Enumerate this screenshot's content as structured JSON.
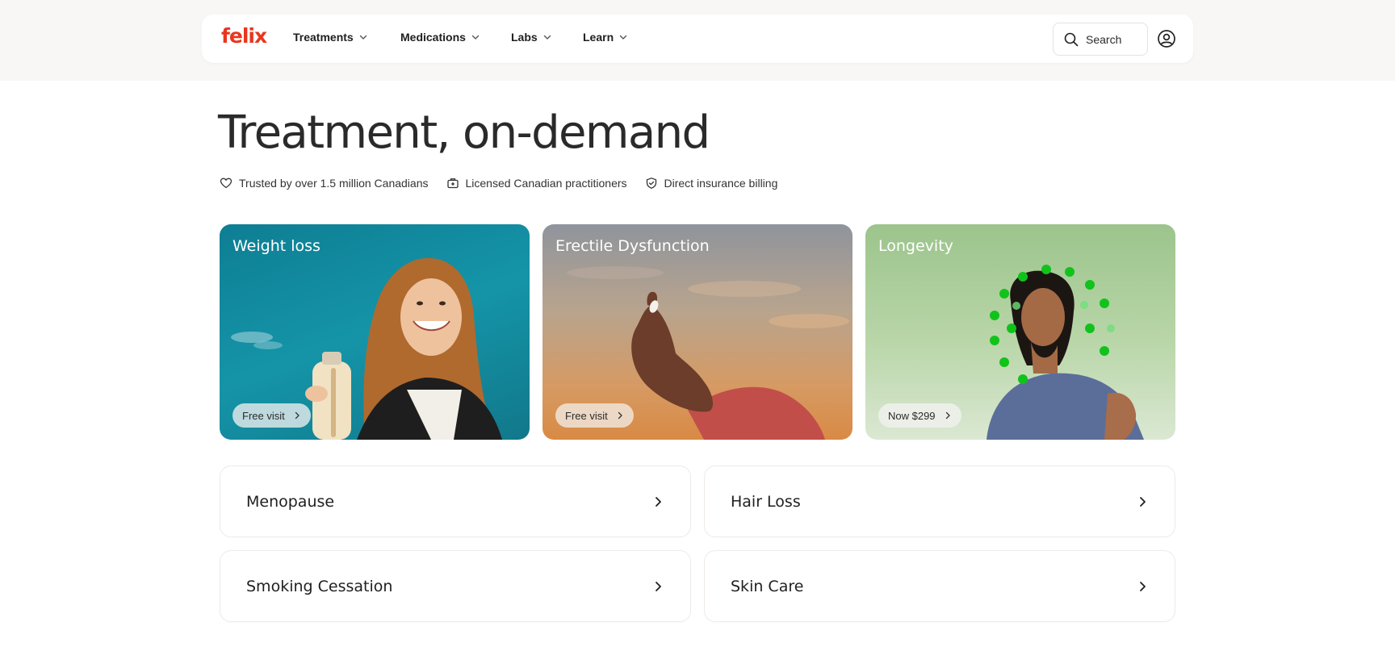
{
  "brand": {
    "logo_text": "felix",
    "accent": "#e8361e"
  },
  "nav": {
    "items": [
      {
        "label": "Treatments"
      },
      {
        "label": "Medications"
      },
      {
        "label": "Labs"
      },
      {
        "label": "Learn"
      }
    ],
    "search_placeholder": "Search",
    "icons": {
      "dropdown": "chevron-down-icon",
      "search": "search-icon",
      "account": "user-circle-icon"
    }
  },
  "hero": {
    "title": "Treatment, on-demand",
    "trust": [
      {
        "icon": "heart-icon",
        "text": "Trusted by over 1.5 million Canadians"
      },
      {
        "icon": "medical-bag-icon",
        "text": "Licensed Canadian practitioners"
      },
      {
        "icon": "shield-check-icon",
        "text": "Direct insurance billing"
      }
    ]
  },
  "featured_cards": [
    {
      "title": "Weight loss",
      "cta": "Free visit",
      "color": "#1594a8"
    },
    {
      "title": "Erectile Dysfunction",
      "cta": "Free visit",
      "color": "#d69a63"
    },
    {
      "title": "Longevity",
      "cta": "Now $299",
      "color": "#9cc48c"
    }
  ],
  "categories": [
    {
      "label": "Menopause"
    },
    {
      "label": "Hair Loss"
    },
    {
      "label": "Smoking Cessation"
    },
    {
      "label": "Skin Care"
    }
  ]
}
